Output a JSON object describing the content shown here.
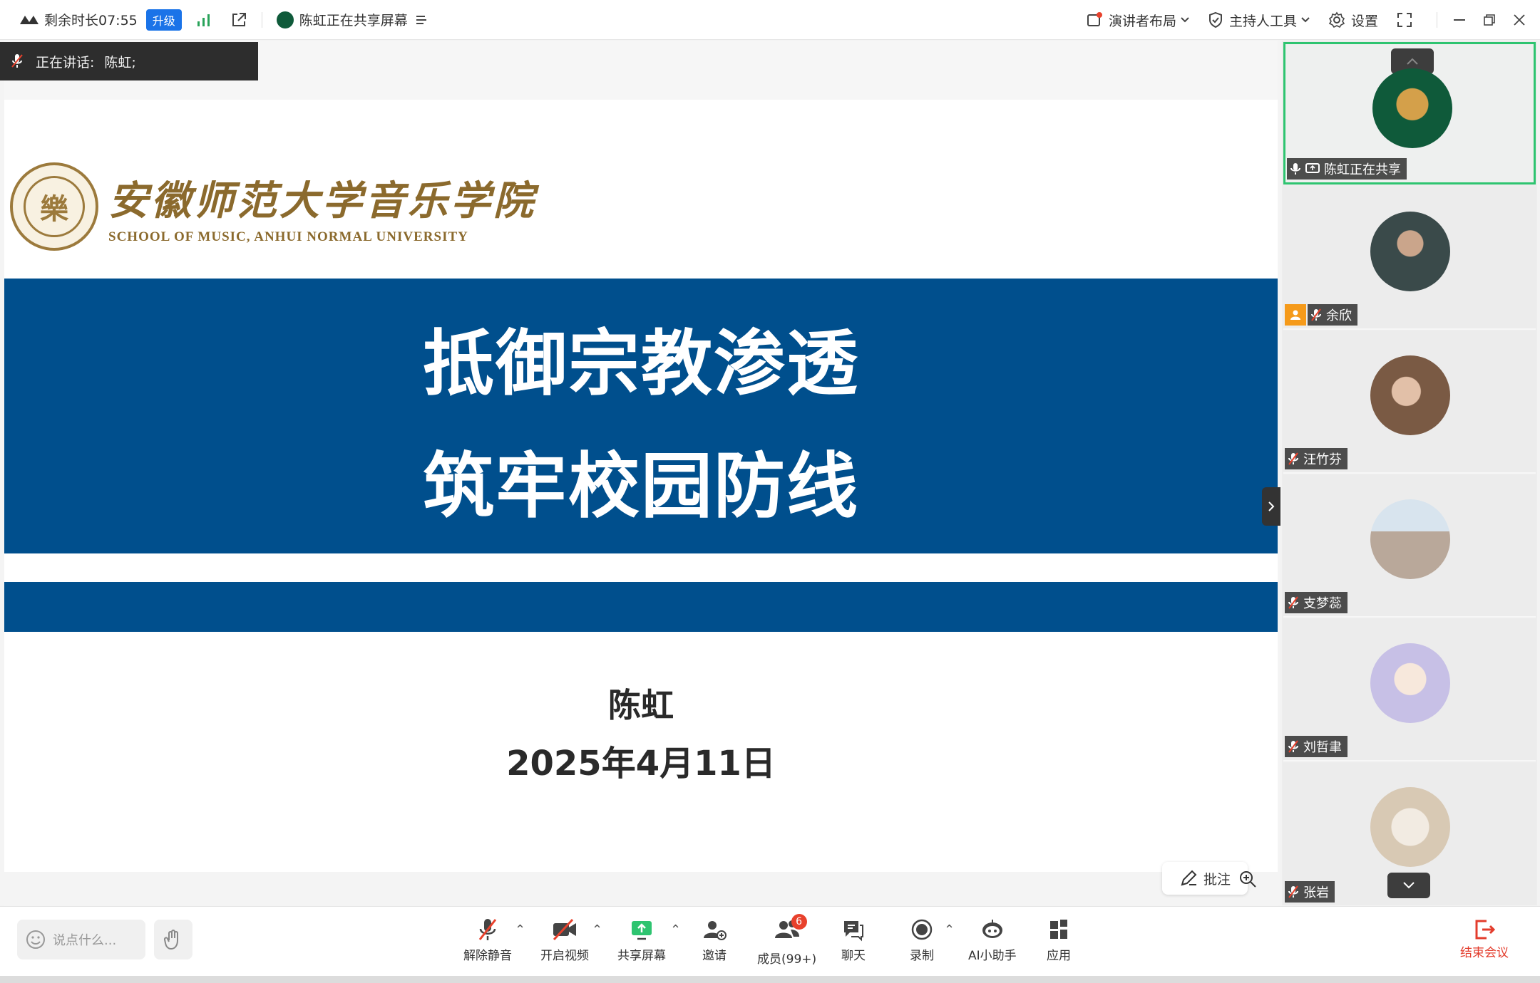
{
  "topbar": {
    "remaining_time": "剩余时长07:55",
    "upgrade_label": "升级",
    "sharing_status": "陈虹正在共享屏幕",
    "layout_label": "演讲者布局",
    "host_tools_label": "主持人工具",
    "settings_label": "设置"
  },
  "speaking_bar": {
    "label": "正在讲话:",
    "speaker": "陈虹;"
  },
  "slide": {
    "school_cn": "安徽师范大学音乐学院",
    "school_en": "SCHOOL OF MUSIC, ANHUI NORMAL UNIVERSITY",
    "seal_char": "樂",
    "title_line1": "抵御宗教渗透",
    "title_line2": "筑牢校园防线",
    "presenter": "陈虹",
    "date": "2025年4月11日"
  },
  "share_controls": {
    "annotate_label": "批注"
  },
  "participants": [
    {
      "name": "陈虹正在共享",
      "sharing": true,
      "host": false,
      "avatar_color": "#0f5a3a"
    },
    {
      "name": "余欣",
      "sharing": false,
      "host": true,
      "avatar_color": "#3a4a4a"
    },
    {
      "name": "汪竹芬",
      "sharing": false,
      "host": false,
      "avatar_color": "#7a5a44"
    },
    {
      "name": "支梦蕊",
      "sharing": false,
      "host": false,
      "avatar_color": "#b9a89a"
    },
    {
      "name": "刘哲聿",
      "sharing": false,
      "host": false,
      "avatar_color": "#c7c0e6"
    },
    {
      "name": "张岩",
      "sharing": false,
      "host": false,
      "avatar_color": "#d8c9b4"
    }
  ],
  "toolbar": {
    "chat_placeholder": "说点什么...",
    "unmute": "解除静音",
    "start_video": "开启视频",
    "share_screen": "共享屏幕",
    "invite": "邀请",
    "members": "成员(99+)",
    "members_badge": "6",
    "chat": "聊天",
    "record": "录制",
    "ai_assistant": "AI小助手",
    "apps": "应用",
    "end_meeting": "结束会议"
  },
  "colors": {
    "banner_blue": "#004f8d",
    "school_gold": "#8b6a2d",
    "active_green": "#2ec470",
    "end_red": "#e33c2c",
    "upgrade_blue": "#1a73e8"
  }
}
